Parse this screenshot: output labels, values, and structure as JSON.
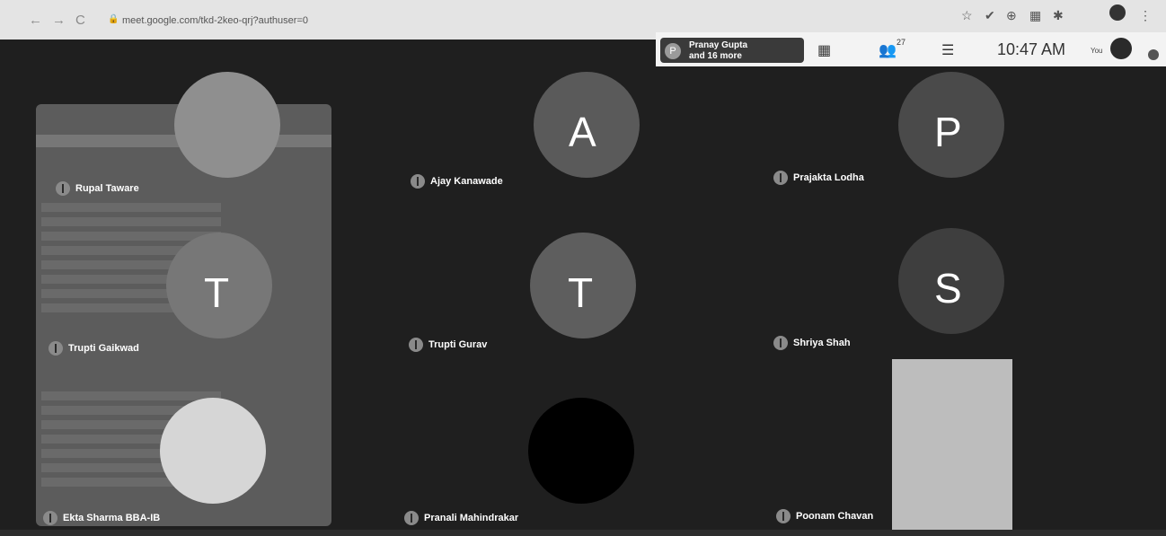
{
  "browser": {
    "back_glyph": "←",
    "forward_glyph": "→",
    "reload_glyph": "C",
    "lock_glyph": "🔒",
    "url": "meet.google.com/tkd-2keo-qrj?authuser=0",
    "ext_glyphs": [
      "☆",
      "✔",
      "⊕",
      "▦",
      "✱",
      "⋮"
    ]
  },
  "meet_header": {
    "participants_chip_initial": "P",
    "participants_line1": "Pranay Gupta",
    "participants_line2": "and 16 more",
    "layout_icon": "▦",
    "people_icon": "👥",
    "people_count": "27",
    "chat_icon": "☰",
    "clock": "10:47 AM",
    "you_label": "You"
  },
  "tiles": [
    {
      "name": "Rupal Taware",
      "kind": "photo"
    },
    {
      "name": "Ajay Kanawade",
      "initial": "A",
      "color": "#5a5a5a"
    },
    {
      "name": "Prajakta Lodha",
      "initial": "P",
      "color": "#4a4a4a"
    },
    {
      "name": "Trupti Gaikwad",
      "initial": "T",
      "color": "#777777"
    },
    {
      "name": "Trupti Gurav",
      "initial": "T",
      "color": "#5e5e5e"
    },
    {
      "name": "Shriya Shah",
      "initial": "S",
      "color": "#3e3e3e"
    },
    {
      "name": "Ekta Sharma BBA-IB",
      "kind": "photo"
    },
    {
      "name": "Pranali Mahindrakar",
      "initial": "",
      "color": "#000000"
    },
    {
      "name": "Poonam Chavan",
      "kind": "video"
    }
  ]
}
